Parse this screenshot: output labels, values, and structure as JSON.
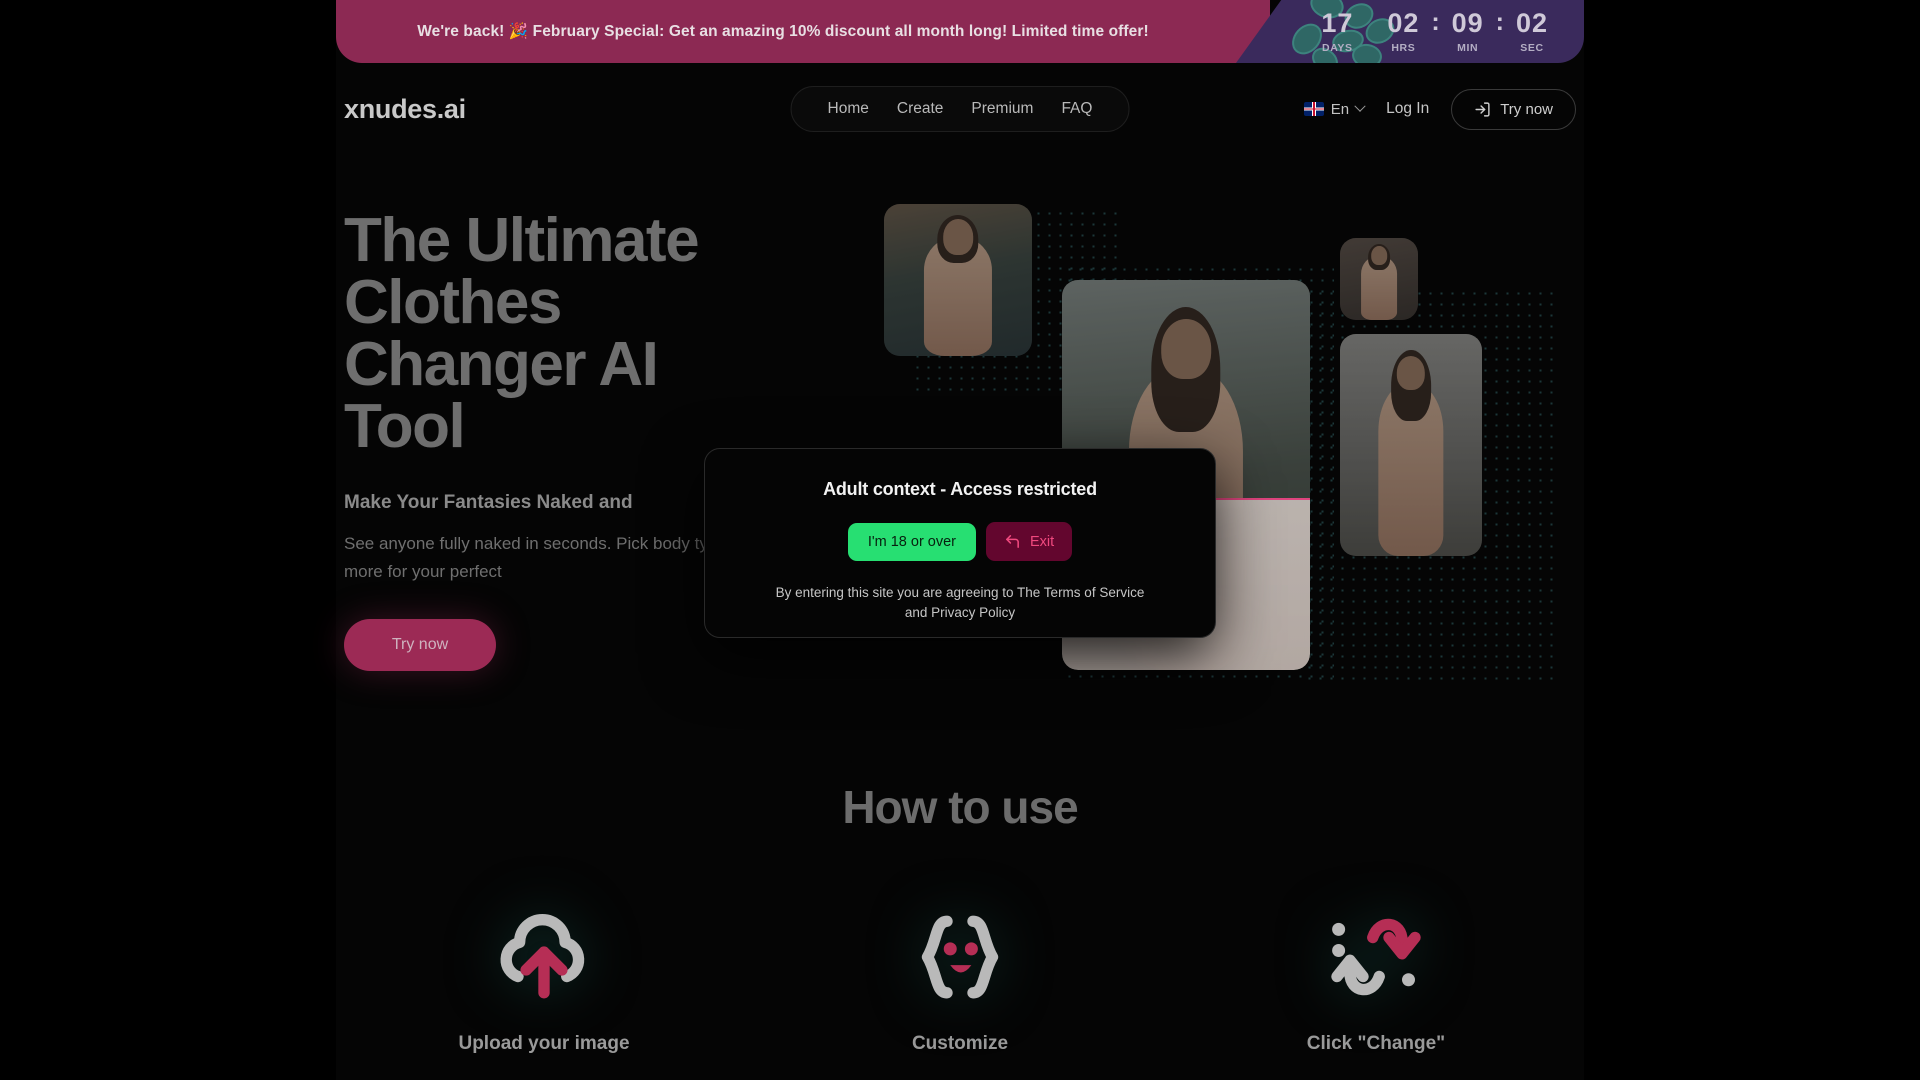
{
  "promo": {
    "message": "We're back! 🎉 February Special: Get an amazing 10% discount all month long! Limited time offer!",
    "emoji": "🎉",
    "bg_color": "#8c2953",
    "timer_bg_color": "#3a2a5c",
    "timer": {
      "days": {
        "value": "17",
        "label": "DAYS"
      },
      "hours": {
        "value": "02",
        "label": "HRS"
      },
      "minutes": {
        "value": "09",
        "label": "MIN"
      },
      "seconds": {
        "value": "02",
        "label": "SEC"
      },
      "separator": ":"
    }
  },
  "header": {
    "logo": "xnudes.ai",
    "nav": [
      {
        "label": "Home"
      },
      {
        "label": "Create"
      },
      {
        "label": "Premium"
      },
      {
        "label": "FAQ"
      }
    ],
    "language": {
      "label": "En",
      "flag": "uk-flag-icon"
    },
    "login_label": "Log In",
    "try_now_label": "Try now"
  },
  "hero": {
    "heading": "The Ultimate Clothes Changer AI Tool",
    "subheading": "Make Your Fantasies Naked and",
    "body": "See anyone fully naked in seconds. Pick body type, and more for your perfect",
    "cta_label": "Try now",
    "cta_color": "#9c2a55"
  },
  "how_to_use": {
    "title": "How to use",
    "steps": [
      {
        "label": "Upload your image",
        "icon": "cloud-upload-icon"
      },
      {
        "label": "Customize",
        "icon": "curly-braces-face-icon"
      },
      {
        "label": "Click \"Change\"",
        "icon": "swap-arrows-icon"
      }
    ],
    "accent_color": "#b62e55"
  },
  "modal": {
    "title": "Adult context - Access restricted",
    "confirm_label": "I'm 18 or over",
    "confirm_color": "#27df72",
    "exit_label": "Exit",
    "exit_color": "#63062e",
    "terms": "By entering this site you are agreeing to The Terms of Service and Privacy Policy"
  }
}
